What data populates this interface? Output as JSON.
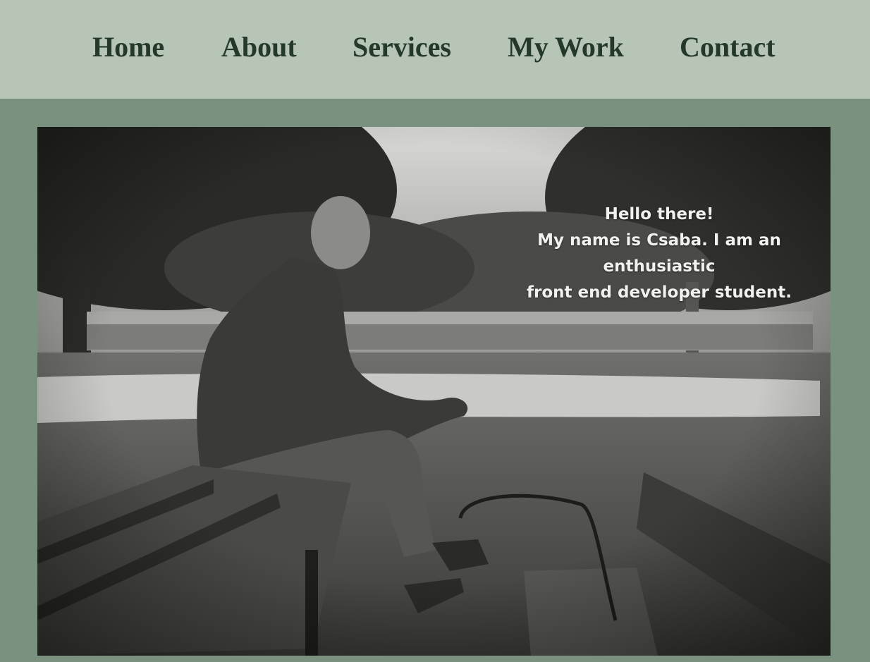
{
  "nav": {
    "items": [
      {
        "label": "Home"
      },
      {
        "label": "About"
      },
      {
        "label": "Services"
      },
      {
        "label": "My Work"
      },
      {
        "label": "Contact"
      }
    ]
  },
  "hero": {
    "greeting": "Hello there!",
    "intro_line1": "My name is Csaba. I am an enthusiastic",
    "intro_line2": "front end developer student.",
    "photo_icon": "portrait-photo"
  },
  "colors": {
    "page_background": "#7a917f",
    "nav_background": "#b6c5b6",
    "nav_text": "#24392a",
    "hero_text": "#f1f1ef"
  }
}
